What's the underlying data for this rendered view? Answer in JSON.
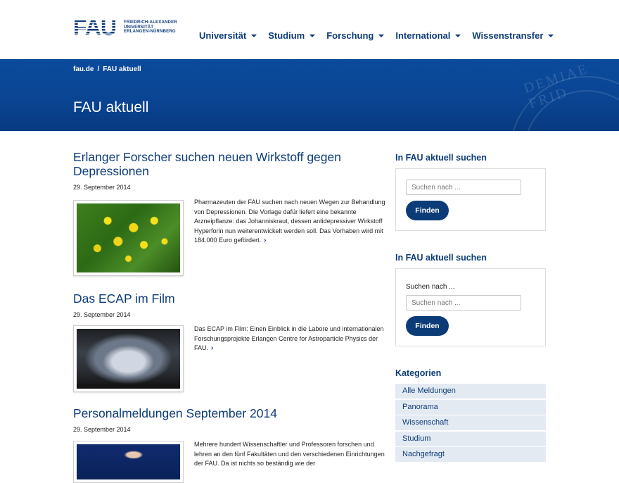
{
  "header": {
    "logo_mark": "FAU",
    "logo_lines": [
      "FRIEDRICH-ALEXANDER",
      "UNIVERSITÄT",
      "ERLANGEN-NÜRNBERG"
    ],
    "nav": [
      {
        "label": "Universität"
      },
      {
        "label": "Studium"
      },
      {
        "label": "Forschung"
      },
      {
        "label": "International"
      },
      {
        "label": "Wissenstransfer"
      }
    ]
  },
  "banner": {
    "breadcrumb": [
      "fau.de",
      "FAU aktuell"
    ],
    "breadcrumb_sep": "/",
    "title": "FAU aktuell",
    "seal_text": "DEMIAE FRID"
  },
  "articles": [
    {
      "title": "Erlanger Forscher suchen neuen Wirkstoff gegen Depressionen",
      "date": "29. September 2014",
      "excerpt": "Pharmazeuten der FAU suchen nach neuen Wegen zur Behandlung von Depressionen. Die Vorlage dafür liefert eine bekannte Arzneipflanze: das Johanniskraut, dessen antidepressiver Wirkstoff Hyperforin nun weiterentwickelt werden soll. Das Vorhaben wird mit 184.000 Euro gefördert.",
      "more": "›"
    },
    {
      "title": "Das ECAP im Film",
      "date": "29. September 2014",
      "excerpt": "Das ECAP im Film: Einen Einblick in die Labore und internationalen Forschungsprojekte Erlangen Centre for Astroparticle Physics der FAU.",
      "more": "›"
    },
    {
      "title": "Personalmeldungen September 2014",
      "date": "29. September 2014",
      "excerpt": "Mehrere hundert Wissenschaftler und Professoren forschen und lehren an den fünf Fakultäten und den verschiedenen Einrichtungen der FAU. Da ist nichts so beständig wie der",
      "more": ""
    }
  ],
  "sidebar": {
    "search1": {
      "title": "In FAU aktuell suchen",
      "placeholder": "Suchen nach ...",
      "button": "Finden"
    },
    "search2": {
      "title": "In FAU aktuell suchen",
      "label": "Suchen nach ...",
      "placeholder": "Suchen nach ...",
      "button": "Finden"
    },
    "categories": {
      "title": "Kategorien",
      "items": [
        "Alle Meldungen",
        "Panorama",
        "Wissenschaft",
        "Studium",
        "Nachgefragt"
      ]
    }
  },
  "colors": {
    "brand": "#0c3c78",
    "banner": "#0a4593",
    "category_bg": "#e4eaf2"
  }
}
